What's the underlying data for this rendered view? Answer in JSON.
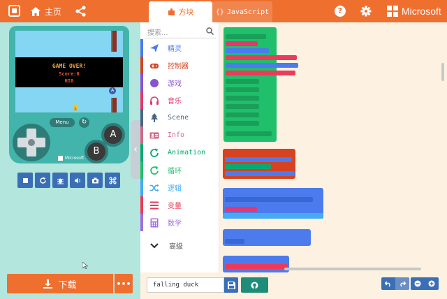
{
  "header": {
    "home_label": "主页",
    "tabs": [
      {
        "label": "方块",
        "active": true
      },
      {
        "label": "JavaScript",
        "active": false
      }
    ],
    "brand": "Microsoft",
    "accent": "#ef6f2e"
  },
  "simulator": {
    "game_over": "GAME OVER!",
    "score": "Score:0",
    "hi": "HI0",
    "badge": "A",
    "menu_label": "Menu",
    "button_a": "A",
    "button_b": "B",
    "brand": "Microsoft"
  },
  "download": {
    "label": "下载",
    "more": "•••"
  },
  "toolbox": {
    "search_placeholder": "搜索...",
    "categories": [
      {
        "label": "精灵",
        "color": "#4b7bec",
        "icon": "paper-plane-icon"
      },
      {
        "label": "控制器",
        "color": "#d54322",
        "icon": "gamepad-icon"
      },
      {
        "label": "游戏",
        "color": "#8854d0",
        "icon": "circle-icon"
      },
      {
        "label": "音乐",
        "color": "#e2376f",
        "icon": "headphones-icon"
      },
      {
        "label": "Scene",
        "color": "#4b6584",
        "icon": "tree-icon"
      },
      {
        "label": "Info",
        "color": "#cf6a87",
        "icon": "id-card-icon"
      },
      {
        "label": "Animation",
        "color": "#03aa74",
        "icon": "refresh-icon"
      },
      {
        "label": "循环",
        "color": "#20bf6b",
        "icon": "loop-icon"
      },
      {
        "label": "逻辑",
        "color": "#45aaf2",
        "icon": "shuffle-icon"
      },
      {
        "label": "变量",
        "color": "#eb3b5a",
        "icon": "list-icon"
      },
      {
        "label": "数学",
        "color": "#9f6ede",
        "icon": "calculator-icon"
      }
    ],
    "advanced_label": "高级"
  },
  "project": {
    "name": "falling duck"
  }
}
